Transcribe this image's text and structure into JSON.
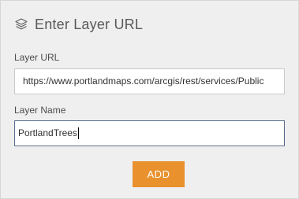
{
  "header": {
    "icon": "layers-icon",
    "title": "Enter Layer URL"
  },
  "form": {
    "url_label": "Layer URL",
    "url_value": "https://www.portlandmaps.com/arcgis/rest/services/Public",
    "name_label": "Layer Name",
    "name_value": "PortlandTrees"
  },
  "actions": {
    "add_label": "ADD"
  },
  "colors": {
    "accent": "#e8912d",
    "panel_bg": "#efefef",
    "focus_border": "#5a6e8c"
  }
}
